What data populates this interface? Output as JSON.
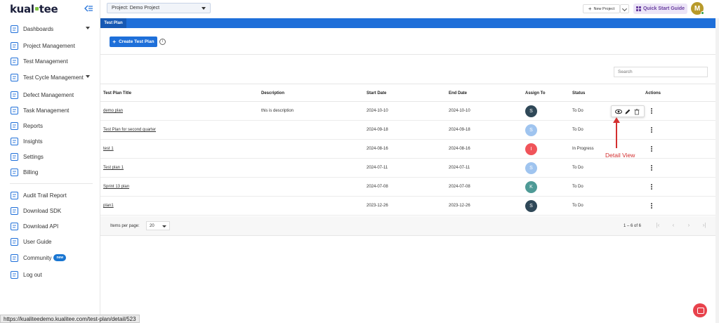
{
  "app": {
    "logo_text_a": "kual",
    "logo_text_b": "tee"
  },
  "sidebar": {
    "items": [
      {
        "label": "Dashboards",
        "icon": "dashboard-icon",
        "has_chevron": true
      },
      {
        "label": "Project Management",
        "icon": "project-tree-icon"
      },
      {
        "label": "Test Management",
        "icon": "test-management-icon"
      },
      {
        "label": "Test Cycle Management",
        "icon": "test-cycle-icon",
        "has_chevron": true
      },
      {
        "label": "Defect Management",
        "icon": "defect-icon"
      },
      {
        "label": "Task Management",
        "icon": "task-icon"
      },
      {
        "label": "Reports",
        "icon": "reports-icon"
      },
      {
        "label": "Insights",
        "icon": "insights-icon"
      },
      {
        "label": "Settings",
        "icon": "gear-icon"
      },
      {
        "label": "Billing",
        "icon": "billing-icon"
      },
      {
        "label": "Audit Trail Report",
        "icon": "audit-icon"
      },
      {
        "label": "Download SDK",
        "icon": "sdk-icon"
      },
      {
        "label": "Download API",
        "icon": "api-icon"
      },
      {
        "label": "User Guide",
        "icon": "user-guide-icon"
      },
      {
        "label": "Community",
        "icon": "community-icon",
        "badge": "new"
      },
      {
        "label": "Log out",
        "icon": "logout-icon"
      }
    ]
  },
  "header": {
    "project_label": "Project:",
    "project_value": "Demo Project",
    "new_project_label": "New Project",
    "quick_start_label": "Quick Start Guide",
    "user_initial": "M"
  },
  "tabs": {
    "active": "Test Plan"
  },
  "toolbar": {
    "create_label": "Create Test Plan",
    "info_symbol": "i"
  },
  "search": {
    "placeholder": "Search"
  },
  "table": {
    "headers": {
      "title": "Test Plan Title",
      "description": "Description",
      "start": "Start Date",
      "end": "End Date",
      "assign": "Assign To",
      "status": "Status",
      "actions": "Actions"
    },
    "rows": [
      {
        "title": "demo plan",
        "description": "this is description",
        "start": "2024-10-10",
        "end": "2024-10-10",
        "initial": "S",
        "color": "#2f4858",
        "status": "To Do"
      },
      {
        "title": "Test Plan for second quarter",
        "description": "",
        "start": "2024-09-18",
        "end": "2024-09-18",
        "initial": "S",
        "color": "#9fc4ef",
        "status": "To Do"
      },
      {
        "title": "test 1",
        "description": "",
        "start": "2024-08-16",
        "end": "2024-08-16",
        "initial": "I",
        "color": "#f0545a",
        "status": "In Progress"
      },
      {
        "title": "Test plan 1",
        "description": "",
        "start": "2024-07-11",
        "end": "2024-07-11",
        "initial": "S",
        "color": "#9fc4ef",
        "status": "To Do"
      },
      {
        "title": "Sprint 13 plan",
        "description": "",
        "start": "2024-07-08",
        "end": "2024-07-08",
        "initial": "K",
        "color": "#4e9a96",
        "status": "To Do"
      },
      {
        "title": "plan1",
        "description": "",
        "start": "2023-12-26",
        "end": "2023-12-26",
        "initial": "S",
        "color": "#2f4858",
        "status": "To Do"
      }
    ]
  },
  "annotation": {
    "label": "Detail View"
  },
  "pagination": {
    "items_per_page_label": "Items per page:",
    "items_per_page_value": "20",
    "range_text": "1 – 6 of 6"
  },
  "status_bar": {
    "url": "https://kualiteedemo.kualitee.com/test-plan/detail/523"
  },
  "colors": {
    "primary": "#1e6fd9",
    "accent_red": "#d32f2f",
    "quick_start_bg": "#ece4f7"
  }
}
